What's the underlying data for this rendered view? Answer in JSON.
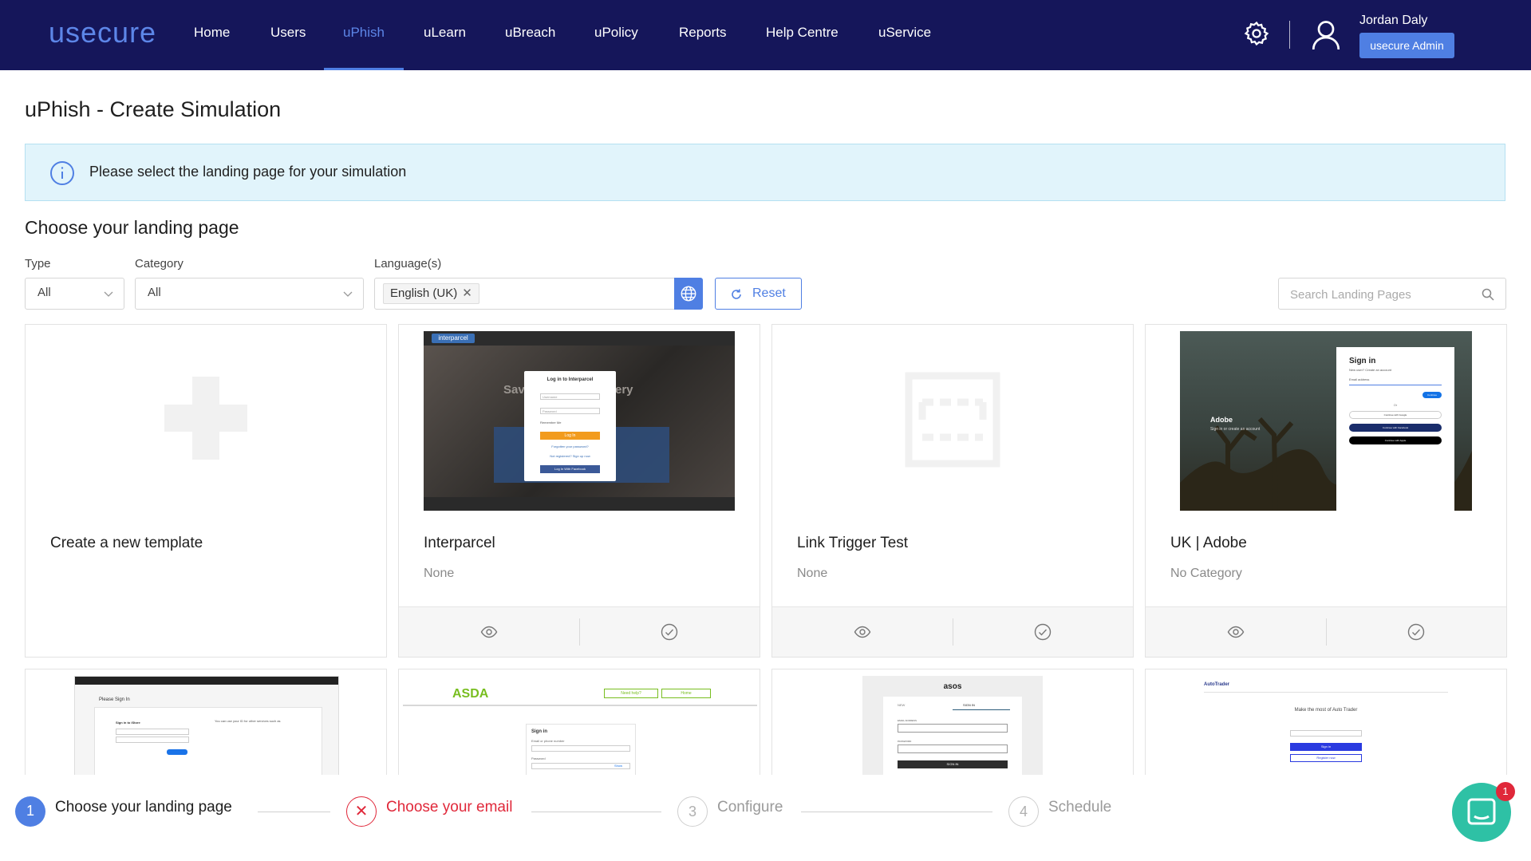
{
  "nav": {
    "logo": "usecure",
    "items": [
      {
        "label": "Home",
        "active": false
      },
      {
        "label": "Users",
        "active": false
      },
      {
        "label": "uPhish",
        "active": true
      },
      {
        "label": "uLearn",
        "active": false
      },
      {
        "label": "uBreach",
        "active": false
      },
      {
        "label": "uPolicy",
        "active": false
      },
      {
        "label": "Reports",
        "active": false
      },
      {
        "label": "Help Centre",
        "active": false
      },
      {
        "label": "uService",
        "active": false
      }
    ],
    "user_name": "Jordan Daly",
    "user_role": "usecure Admin",
    "icons": {
      "settings": "gear-icon",
      "account": "user-icon"
    }
  },
  "page": {
    "title": "uPhish - Create Simulation",
    "info": "Please select the landing page for your simulation",
    "section_title": "Choose your landing page"
  },
  "filters": {
    "type_label": "Type",
    "type_value": "All",
    "category_label": "Category",
    "category_value": "All",
    "language_label": "Language(s)",
    "language_tag": "English (UK)",
    "reset_label": "Reset",
    "search_placeholder": "Search Landing Pages"
  },
  "cards": {
    "create_label": "Create a new template",
    "items": [
      {
        "name": "Interparcel",
        "category": "None"
      },
      {
        "name": "Link Trigger Test",
        "category": "None"
      },
      {
        "name": "UK | Adobe",
        "category": "No Category"
      }
    ],
    "thumb_text": {
      "interparcel_brand": "interparcel",
      "interparcel_login": "Log in to Interparcel",
      "interparcel_username": "Username",
      "interparcel_password": "Password",
      "interparcel_remember": "Remember Me",
      "interparcel_login_btn": "Log In",
      "interparcel_forgot": "Forgotten your password?",
      "interparcel_signup": "Not registered? Sign up now",
      "interparcel_facebook": "Log In With Facebook",
      "interparcel_bg_left": "Save",
      "interparcel_bg_right": "ery",
      "adobe_brand": "Adobe",
      "adobe_tagline": "Sign in or create an account",
      "adobe_signin": "Sign in",
      "adobe_newuser": "New user? Create an account",
      "adobe_email": "Email address",
      "adobe_continue": "Continue",
      "adobe_or": "Or",
      "adobe_google": "Continue with Google",
      "adobe_facebook": "Continue with Facebook",
      "adobe_apple": "Continue with Apple",
      "apple_signin": "Please Sign In",
      "apple_store": "Sign in to iStore",
      "apple_services": "You can use your ID for other services such as",
      "asda_logo": "ASDA",
      "asda_help": "Need help?",
      "asda_home": "Home",
      "asda_signin": "Sign in",
      "asda_email": "Email or phone number",
      "asda_password": "Password",
      "asda_show": "Show",
      "asos_logo": "asos",
      "asos_new": "NEW",
      "asos_signin_tab": "SIGN IN",
      "asos_email": "EMAIL ADDRESS",
      "asos_password": "PASSWORD",
      "asos_btn": "SIGN IN",
      "autotrader_logo": "AutoTrader",
      "autotrader_heading": "Make the most of Auto Trader",
      "autotrader_signin": "Sign in",
      "autotrader_register": "Register now"
    }
  },
  "stepper": {
    "steps": [
      {
        "num": "1",
        "label": "Choose your landing page",
        "state": "active"
      },
      {
        "num": "✕",
        "label": "Choose your email",
        "state": "error"
      },
      {
        "num": "3",
        "label": "Configure",
        "state": "pending"
      },
      {
        "num": "4",
        "label": "Schedule",
        "state": "pending"
      }
    ]
  },
  "chat": {
    "badge": "1"
  },
  "colors": {
    "nav_bg": "#15165a",
    "accent": "#4f7fe3",
    "info_bg": "#e1f4fb",
    "error": "#e0283a",
    "chat": "#2ec1a5"
  }
}
